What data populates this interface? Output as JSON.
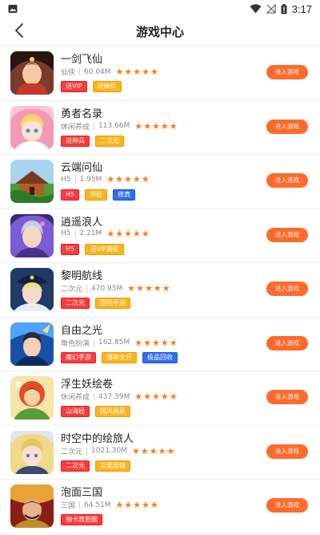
{
  "status_bar": {
    "time": "3:17",
    "icons": [
      "gallery-icon",
      "wifi-icon",
      "no-signal-icon",
      "battery-icon"
    ]
  },
  "header": {
    "title": "游戏中心",
    "back_icon": "chevron-left-icon"
  },
  "colors": {
    "accent": "#ff6a2c",
    "star": "#ff7a1a",
    "tag_red": "#ff3a3a",
    "tag_orange": "#ffb31a",
    "tag_blue": "#2f6df0"
  },
  "games": [
    {
      "name": "一剑飞仙",
      "category": "仙侠",
      "size": "60.04M",
      "rating": 5,
      "tags": [
        {
          "text": "送VIP",
          "color": "red"
        },
        {
          "text": "送神兵",
          "color": "orange"
        }
      ],
      "button": "进入游戏"
    },
    {
      "name": "勇者名录",
      "category": "休闲养成",
      "size": "113.66M",
      "rating": 5,
      "tags": [
        {
          "text": "送神兵",
          "color": "red"
        },
        {
          "text": "二次元",
          "color": "orange"
        }
      ],
      "button": "进入游戏"
    },
    {
      "name": "云端问仙",
      "category": "H5",
      "size": "1.95M",
      "rating": 5,
      "tags": [
        {
          "text": "H5",
          "color": "red"
        },
        {
          "text": "师徒",
          "color": "orange"
        },
        {
          "text": "修真",
          "color": "blue"
        }
      ],
      "button": "进入游戏"
    },
    {
      "name": "逍遥浪人",
      "category": "H5",
      "size": "2.21M",
      "rating": 5,
      "tags": [
        {
          "text": "H5",
          "color": "red"
        },
        {
          "text": "送VIP满级",
          "color": "orange"
        }
      ],
      "button": "进入游戏"
    },
    {
      "name": "黎明航线",
      "category": "二次元",
      "size": "470.95M",
      "rating": 5,
      "tags": [
        {
          "text": "二次元",
          "color": "red"
        },
        {
          "text": "冒险手游",
          "color": "orange"
        }
      ],
      "button": "进入游戏"
    },
    {
      "name": "自由之光",
      "category": "角色扮演",
      "size": "162.85M",
      "rating": 5,
      "tags": [
        {
          "text": "魔幻手游",
          "color": "red"
        },
        {
          "text": "爆率全开",
          "color": "orange"
        },
        {
          "text": "极品回收",
          "color": "blue"
        }
      ],
      "button": "进入游戏"
    },
    {
      "name": "浮生妖绘卷",
      "category": "休闲养成",
      "size": "437.39M",
      "rating": 5,
      "tags": [
        {
          "text": "山海经",
          "color": "red"
        },
        {
          "text": "国风画质",
          "color": "orange"
        }
      ],
      "button": "进入游戏"
    },
    {
      "name": "时空中的绘旅人",
      "category": "二次元",
      "size": "1021.30M",
      "rating": 5,
      "tags": [
        {
          "text": "二次元",
          "color": "red"
        },
        {
          "text": "恋爱剧情",
          "color": "orange"
        }
      ],
      "button": "进入游戏"
    },
    {
      "name": "泡面三国",
      "category": "三国",
      "size": "64.51M",
      "rating": 5,
      "tags": [
        {
          "text": "抽卡真割据",
          "color": "red"
        }
      ],
      "button": "进入游戏"
    }
  ]
}
